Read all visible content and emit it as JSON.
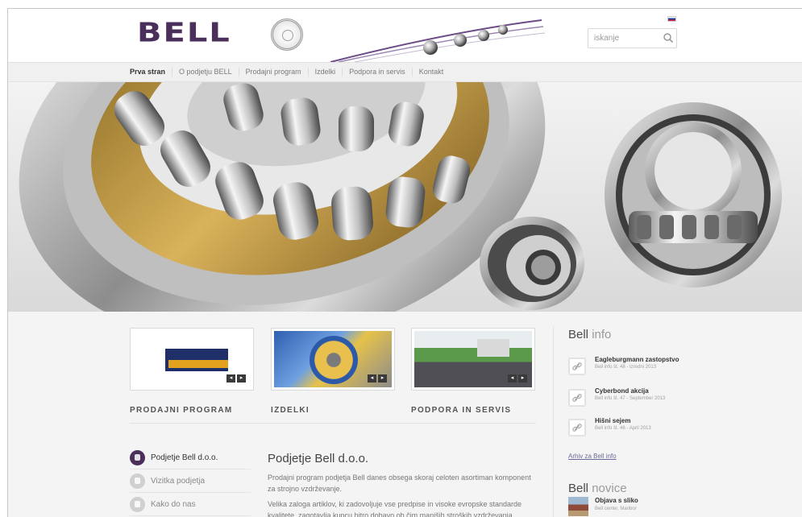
{
  "header": {
    "logo_text": "BELL",
    "search_placeholder": "iskanje"
  },
  "nav": {
    "items": [
      "Prva stran",
      "O podjetju BELL",
      "Prodajni program",
      "Izdelki",
      "Podpora in servis",
      "Kontakt"
    ]
  },
  "tiles": [
    {
      "title": "PRODAJNI PROGRAM"
    },
    {
      "title": "IZDELKI"
    },
    {
      "title": "PODPORA IN SERVIS"
    }
  ],
  "tile_arrows": {
    "prev": "◂",
    "next": "▸"
  },
  "side_menu": [
    {
      "label": "Podjetje Bell d.o.o."
    },
    {
      "label": "Vizitka podjetja"
    },
    {
      "label": "Kako do nas"
    }
  ],
  "article": {
    "title": "Podjetje Bell d.o.o.",
    "p1": "Prodajni program podjetja Bell danes obsega skoraj celoten asortiman komponent za strojno vzdrževanje.",
    "p2": "Velika zaloga artiklov, ki zadovoljuje vse predpise in visoke evropske standarde kvalitete, zagotavlja kupcu hitro dobavo ob čim manjših stroških vzdrževanja."
  },
  "bell_info": {
    "title_bold": "Bell",
    "title_light": "info",
    "items": [
      {
        "title": "Eagleburgmann zastopstvo",
        "sub": "Bell info št. 48 - Izredni 2013"
      },
      {
        "title": "Cyberbond akcija",
        "sub": "Bell info št. 47 - September 2013"
      },
      {
        "title": "Hišni sejem",
        "sub": "Bell info št. 46 - April 2013"
      }
    ],
    "archive": "Arhiv za Bell info"
  },
  "bell_novice": {
    "title_bold": "Bell",
    "title_light": "novice",
    "items": [
      {
        "title": "Objava s sliko",
        "sub": "Bell center, Maribor"
      }
    ]
  },
  "colors": {
    "brand": "#4a2f5a",
    "background": "#f4f4f4"
  }
}
